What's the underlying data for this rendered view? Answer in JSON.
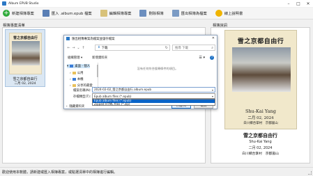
{
  "window": {
    "title": "Album EPUB Studio",
    "controls": [
      "–",
      "□",
      "✕"
    ]
  },
  "toolbar": {
    "new_album": "新建相簿專案",
    "import_epub": "匯入 .album.epub 檔案",
    "edit_album": "編輯相簿專案",
    "delete_album": "刪除相簿",
    "export_album": "匯出相簿為檔案",
    "help": "線上說明書"
  },
  "left_panel": {
    "title": "相簿專案清單",
    "items": [
      {
        "title": "雪之京都自由行",
        "cover_title": "雪之京都自由行",
        "date": "二月 02, 2024"
      }
    ]
  },
  "right_panel": {
    "title": "相簿資訊",
    "cover": {
      "title": "雪之京都自由行",
      "author": "Shu-Kai Yang",
      "date": "二月 02, 2024",
      "location": "白川鄉合掌村　京都嵐山"
    },
    "info": {
      "title": "雪之京都自由行",
      "author": "Shu-Kai Yang",
      "date": "二月 02, 2024",
      "location": "白川鄉合掌村　京都嵐山"
    }
  },
  "dialog": {
    "title": "匯出相簿專案為檔案並儲存檔案",
    "address": "下載",
    "search_placeholder": "搜尋 下載",
    "organize": "組織管理 ▾",
    "new_folder": "新增資料夾",
    "empty_message": "沒有任何符合搜尋條件的項目。",
    "nav_items": [
      "桌面 - 個人",
      "公用",
      "本機",
      "分享的最愛"
    ],
    "filename_label": "檔案名稱(N):",
    "filename_value": "2024-02-02_雪之京都自由行.album.epub",
    "filetype_label": "存檔類型(T):",
    "filetype_selected": "Epub album files (*.epub)",
    "filetype_options": [
      "Epub album files (*.epub)",
      "Zipped HTML files (*.zip)"
    ],
    "hide_folders": "隱藏資料夾",
    "save_button": "存檔(S)",
    "cancel_button": "取消"
  },
  "status_bar": {
    "message": "歡迎使用本軟體，請新建或匯入相簿專案，或點選清單中的相簿進行編輯。"
  }
}
